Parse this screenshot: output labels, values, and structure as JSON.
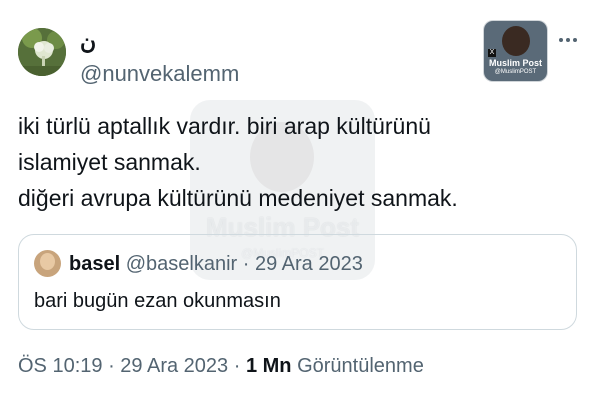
{
  "author": {
    "display_name": "ن",
    "handle": "@nunvekalemm"
  },
  "tweet": {
    "lines": [
      "iki türlü aptallık vardır. biri arap kültürünü",
      "islamiyet sanmak.",
      "diğeri avrupa kültürünü medeniyet sanmak."
    ]
  },
  "quoted": {
    "name": "basel",
    "handle": "@baselkanir",
    "date": "29 Ara 2023",
    "text": "bari bugün ezan okunmasın"
  },
  "meta": {
    "time": "ÖS 10:19",
    "date": "29 Ara 2023",
    "views_count": "1 Mn",
    "views_label": "Görüntülenme"
  },
  "badge": {
    "title": "Muslim Post",
    "subtitle": "@MuslimPOST",
    "x_mark": "X"
  },
  "watermark": {
    "title": "Muslim Post",
    "subtitle": "@MuslimPOST"
  },
  "icons": {
    "more": "more-icon"
  }
}
